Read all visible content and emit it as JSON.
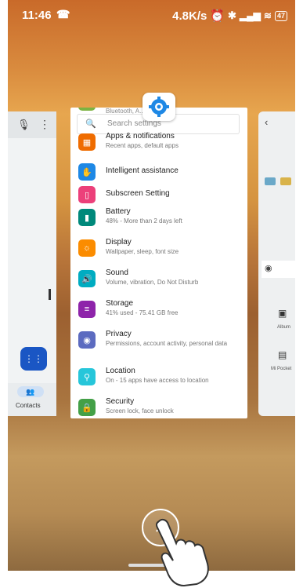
{
  "status_bar": {
    "time": "11:46",
    "network_speed": "4.8K/s",
    "battery": "47"
  },
  "left_card": {
    "contacts_label": "Contacts"
  },
  "settings_card": {
    "top_partial_text": "Bluetooth, A... NFC",
    "search_placeholder": "Search settings",
    "items": [
      {
        "title": "Apps & notifications",
        "subtitle": "Recent apps, default apps",
        "color": "#ef6c00"
      },
      {
        "title": "Intelligent assistance",
        "subtitle": "",
        "color": "#1e88e5"
      },
      {
        "title": "Subscreen Setting",
        "subtitle": "",
        "color": "#ec407a"
      },
      {
        "title": "Battery",
        "subtitle": "48% - More than 2 days left",
        "color": "#00897b"
      },
      {
        "title": "Display",
        "subtitle": "Wallpaper, sleep, font size",
        "color": "#fb8c00"
      },
      {
        "title": "Sound",
        "subtitle": "Volume, vibration, Do Not Disturb",
        "color": "#00acc1"
      },
      {
        "title": "Storage",
        "subtitle": "41% used - 75.41 GB free",
        "color": "#8e24aa"
      },
      {
        "title": "Privacy",
        "subtitle": "Permissions, account activity, personal data",
        "color": "#5c6bc0"
      },
      {
        "title": "Location",
        "subtitle": "On - 15 apps have access to location",
        "color": "#26c6da"
      },
      {
        "title": "Security",
        "subtitle": "Screen lock, face unlock",
        "color": "#43a047"
      }
    ]
  },
  "right_card": {
    "album_label": "Album",
    "mi_pocket_label": "Mi Pocket"
  }
}
